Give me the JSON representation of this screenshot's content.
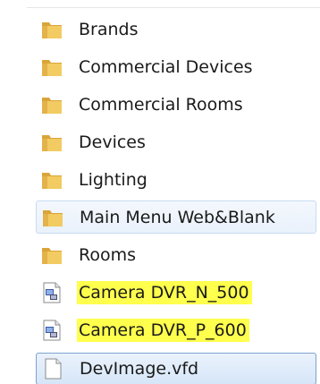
{
  "file_list": {
    "items": [
      {
        "name": "Brands",
        "icon": "folder-icon"
      },
      {
        "name": "Commercial Devices",
        "icon": "folder-icon"
      },
      {
        "name": "Commercial Rooms",
        "icon": "folder-icon"
      },
      {
        "name": "Devices",
        "icon": "folder-icon"
      },
      {
        "name": "Lighting",
        "icon": "folder-icon"
      },
      {
        "name": "Main Menu Web&Blank",
        "icon": "folder-icon",
        "state": "hover"
      },
      {
        "name": "Rooms",
        "icon": "folder-icon"
      },
      {
        "name": "Camera DVR_N_500",
        "icon": "device-file-icon",
        "highlighted": true
      },
      {
        "name": "Camera DVR_P_600",
        "icon": "device-file-icon",
        "highlighted": true
      },
      {
        "name": "DevImage.vfd",
        "icon": "blank-file-icon",
        "state": "selected"
      }
    ]
  },
  "colors": {
    "folder": "#e8b94a",
    "highlight": "#ffff4d",
    "hover_border": "#c7dbf1",
    "selected_border": "#7da2ce"
  }
}
